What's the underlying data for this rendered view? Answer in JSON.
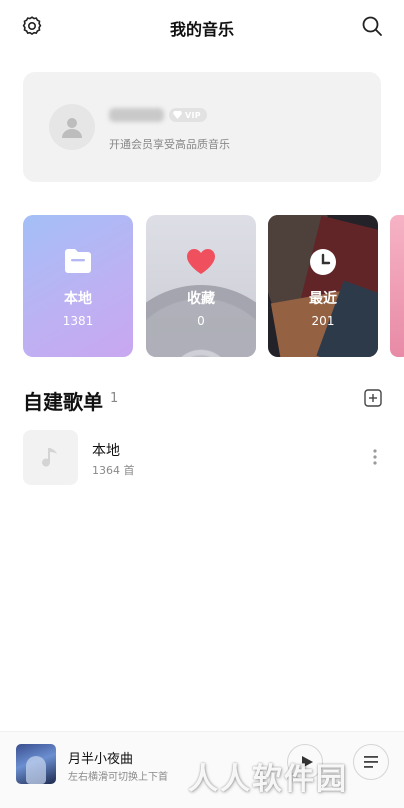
{
  "header": {
    "title": "我的音乐",
    "left_icon": "gear-icon",
    "right_icon": "search-icon"
  },
  "profile": {
    "vip_label": "VIP",
    "subtitle": "开通会员享受高品质音乐"
  },
  "cards": [
    {
      "label": "本地",
      "count": "1381",
      "icon": "folder-icon"
    },
    {
      "label": "收藏",
      "count": "0",
      "icon": "heart-icon"
    },
    {
      "label": "最近",
      "count": "201",
      "icon": "clock-icon"
    }
  ],
  "playlists_section": {
    "title": "自建歌单",
    "count": "1",
    "items": [
      {
        "name": "本地",
        "count": "1364 首"
      }
    ]
  },
  "player": {
    "title": "月半小夜曲",
    "subtitle": "左右横滑可切换上下首"
  },
  "watermark": "人人软件园",
  "colors": {
    "local_card": "#a9bdf6",
    "heart": "#f0505e",
    "background": "#ffffff",
    "card_gray": "#f2f2f2"
  }
}
